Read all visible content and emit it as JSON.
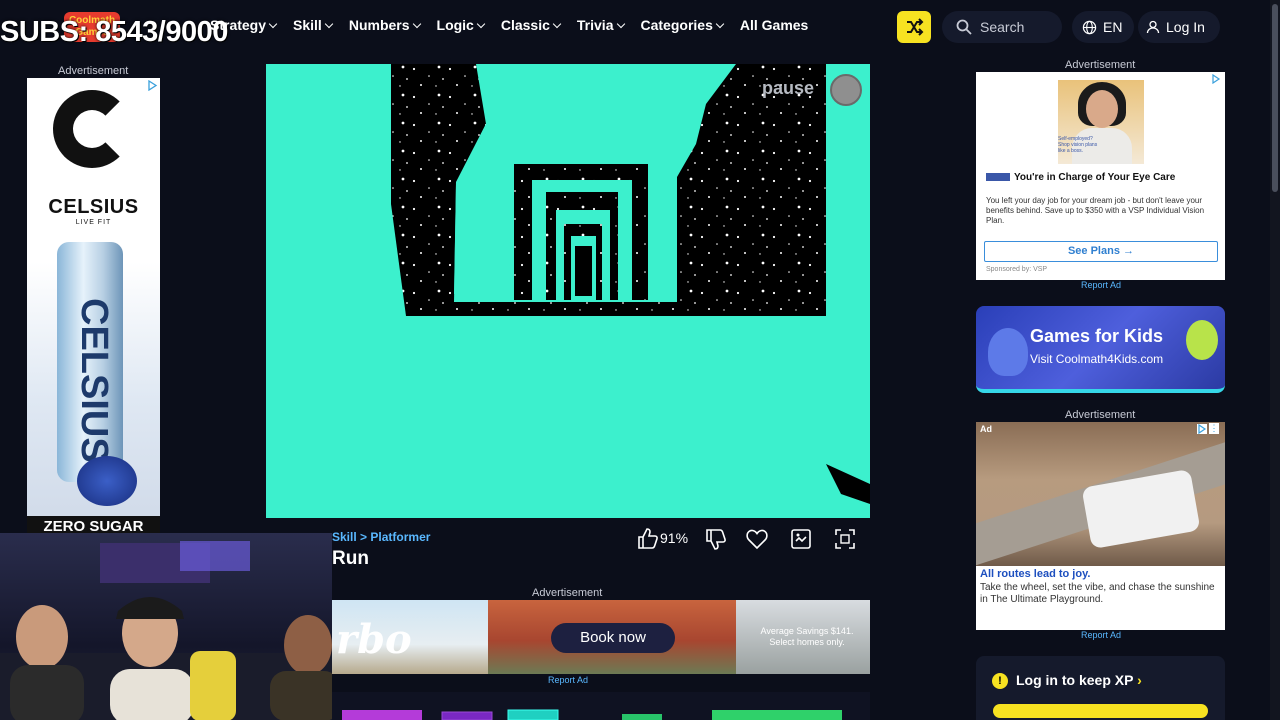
{
  "overlay": {
    "subs": "SUBS: 8543/9000"
  },
  "header": {
    "logo": "Coolmath Games",
    "nav": [
      {
        "label": "Strategy",
        "dropdown": true
      },
      {
        "label": "Skill",
        "dropdown": true
      },
      {
        "label": "Numbers",
        "dropdown": true
      },
      {
        "label": "Logic",
        "dropdown": true
      },
      {
        "label": "Classic",
        "dropdown": true
      },
      {
        "label": "Trivia",
        "dropdown": true
      },
      {
        "label": "Categories",
        "dropdown": true
      },
      {
        "label": "All Games",
        "dropdown": false
      }
    ],
    "search_placeholder": "Search",
    "language": "EN",
    "login": "Log In"
  },
  "left_ad": {
    "label": "Advertisement",
    "brand": "CELSIUS",
    "tagline": "LIVE FIT",
    "can_text": "CELSIUS",
    "footer": "ZERO SUGAR"
  },
  "game": {
    "pause_label": "pause",
    "breadcrumb_category": "Skill",
    "breadcrumb_sep": ">",
    "breadcrumb_sub": "Platformer",
    "title": "Run",
    "rating": "91%",
    "colors": {
      "accent": "#3cf0cd",
      "space": "#000000"
    }
  },
  "bottom_ad": {
    "label": "Advertisement",
    "brand_fragment": "rbo",
    "cta": "Book now",
    "savings": "Average Savings $141. Select homes only.",
    "report": "Report Ad"
  },
  "vsp_ad": {
    "label": "Advertisement",
    "bubble": "Self-employed? Shop vision plans like a boss.",
    "title": "You're in Charge of Your Eye Care",
    "body": "You left your day job for your dream job - but don't leave your benefits behind. Save up to $350 with a VSP Individual Vision Plan.",
    "cta": "See Plans",
    "sponsor": "Sponsored by: VSP",
    "report": "Report Ad"
  },
  "kids_banner": {
    "title": "Games for Kids",
    "subtitle": "Visit Coolmath4Kids.com"
  },
  "car_ad": {
    "label": "Advertisement",
    "tag": "Ad",
    "title": "All routes lead to joy.",
    "body": "Take the wheel, set the vibe, and chase the sunshine in The Ultimate Playground.",
    "report": "Report Ad"
  },
  "xp_card": {
    "text": "Log in to keep XP"
  }
}
